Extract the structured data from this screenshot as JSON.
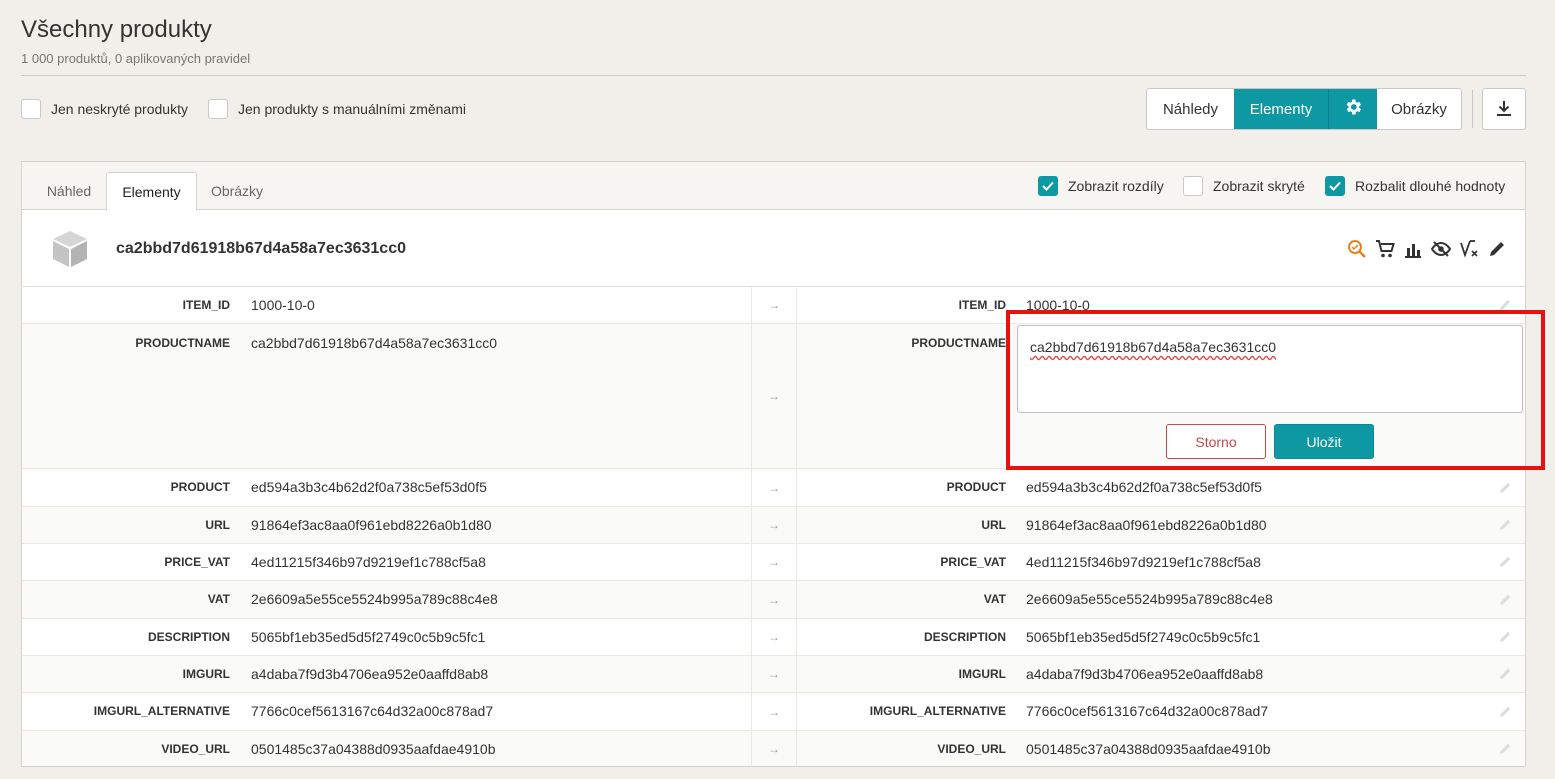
{
  "header": {
    "title": "Všechny produkty",
    "subtitle": "1 000 produktů, 0 aplikovaných pravidel"
  },
  "filters": {
    "only_visible": "Jen neskryté produkty",
    "only_manual": "Jen produkty s manuálními změnami"
  },
  "view_switch": {
    "preview": "Náhledy",
    "elements": "Elementy",
    "images": "Obrázky",
    "active": "Elementy"
  },
  "tabs": [
    {
      "label": "Náhled"
    },
    {
      "label": "Elementy"
    },
    {
      "label": "Obrázky"
    }
  ],
  "options": {
    "show_diff": "Zobrazit rozdíly",
    "show_diff_checked": true,
    "show_hidden": "Zobrazit skryté",
    "show_hidden_checked": false,
    "expand_long": "Rozbalit dlouhé hodnoty",
    "expand_long_checked": true
  },
  "product": {
    "id": "ca2bbd7d61918b67d4a58a7ec3631cc0"
  },
  "rows": [
    {
      "key": "ITEM_ID",
      "left": "1000-10-0",
      "right": "1000-10-0"
    },
    {
      "key": "PRODUCTNAME",
      "left": "ca2bbd7d61918b67d4a58a7ec3631cc0",
      "right": "ca2bbd7d61918b67d4a58a7ec3631cc0"
    },
    {
      "key": "PRODUCT",
      "left": "ed594a3b3c4b62d2f0a738c5ef53d0f5",
      "right": "ed594a3b3c4b62d2f0a738c5ef53d0f5"
    },
    {
      "key": "URL",
      "left": "91864ef3ac8aa0f961ebd8226a0b1d80",
      "right": "91864ef3ac8aa0f961ebd8226a0b1d80"
    },
    {
      "key": "PRICE_VAT",
      "left": "4ed11215f346b97d9219ef1c788cf5a8",
      "right": "4ed11215f346b97d9219ef1c788cf5a8"
    },
    {
      "key": "VAT",
      "left": "2e6609a5e55ce5524b995a789c88c4e8",
      "right": "2e6609a5e55ce5524b995a789c88c4e8"
    },
    {
      "key": "DESCRIPTION",
      "left": "5065bf1eb35ed5d5f2749c0c5b9c5fc1",
      "right": "5065bf1eb35ed5d5f2749c0c5b9c5fc1"
    },
    {
      "key": "IMGURL",
      "left": "a4daba7f9d3b4706ea952e0aaffd8ab8",
      "right": "a4daba7f9d3b4706ea952e0aaffd8ab8"
    },
    {
      "key": "IMGURL_ALTERNATIVE",
      "left": "7766c0cef5613167c64d32a00c878ad7",
      "right": "7766c0cef5613167c64d32a00c878ad7"
    },
    {
      "key": "VIDEO_URL",
      "left": "0501485c37a04388d0935aafdae4910b",
      "right": "0501485c37a04388d0935aafdae4910b"
    }
  ],
  "editor": {
    "value": "ca2bbd7d61918b67d4a58a7ec3631cc0",
    "cancel_label": "Storno",
    "save_label": "Uložit"
  },
  "colors": {
    "accent": "#0e98a4",
    "cancel": "#c94747",
    "highlight": "#e8110f",
    "background": "#f1efe9"
  }
}
